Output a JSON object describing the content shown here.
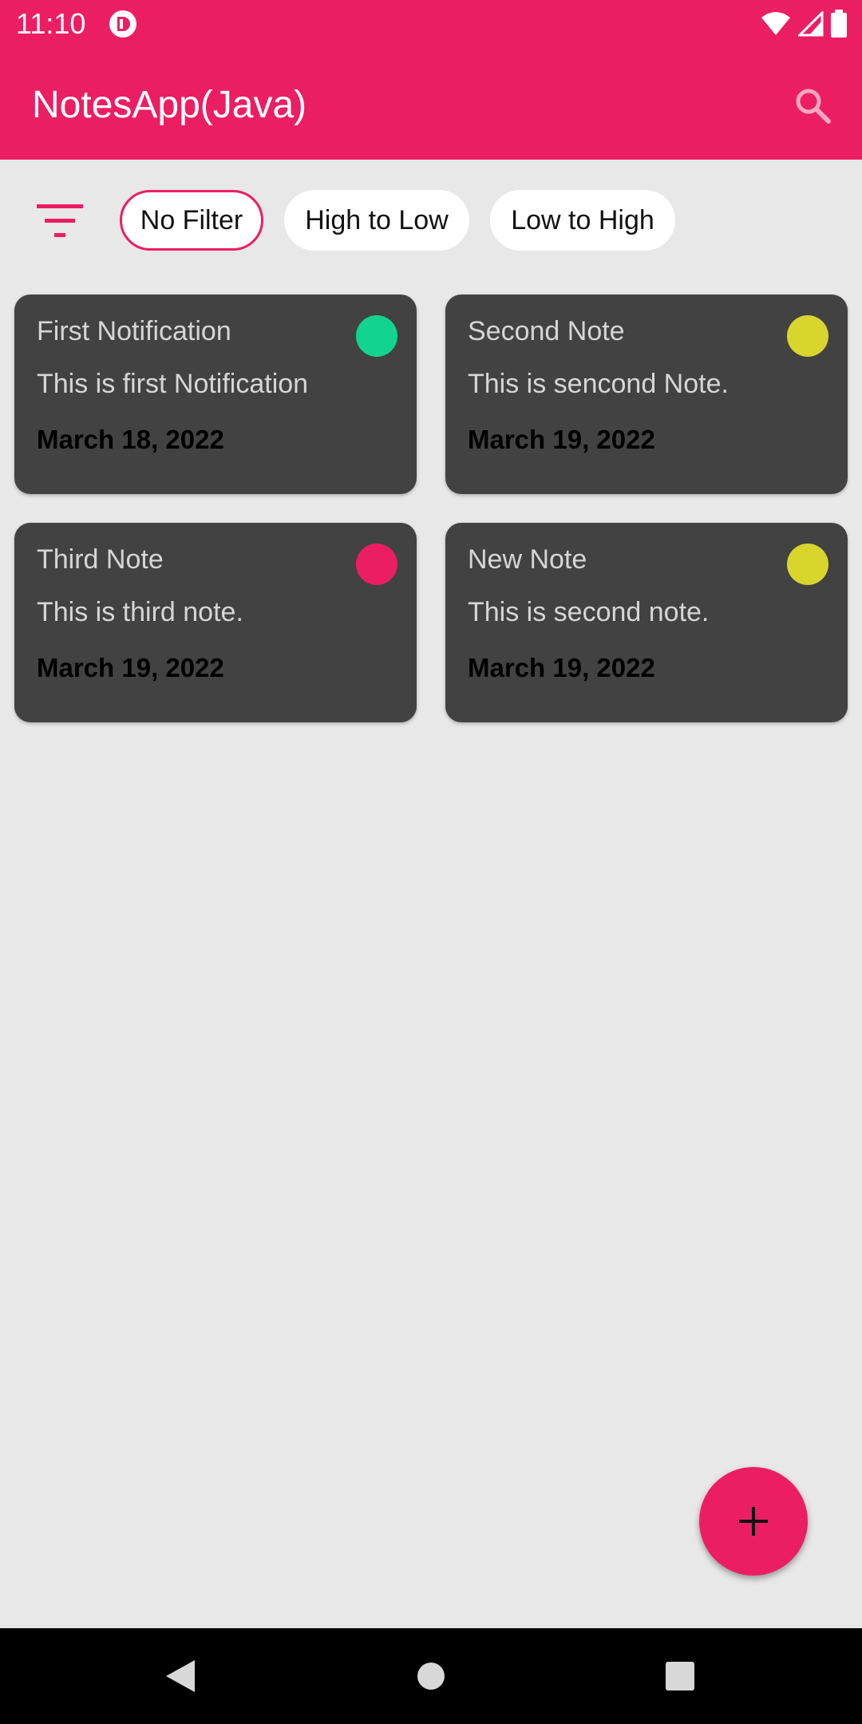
{
  "status_bar": {
    "time": "11:10",
    "icons": [
      "app-notification-icon",
      "wifi-icon",
      "cell-signal-icon",
      "battery-icon"
    ]
  },
  "app_bar": {
    "title": "NotesApp(Java)",
    "search_icon": "search-icon"
  },
  "filters": {
    "icon": "filter-icon",
    "chips": [
      {
        "label": "No Filter",
        "selected": true
      },
      {
        "label": "High to Low",
        "selected": false
      },
      {
        "label": "Low to High",
        "selected": false
      }
    ]
  },
  "notes": [
    {
      "title": "First Notification",
      "body": "This is first Notification",
      "date": "March 18, 2022",
      "priority_color": "#12d38f"
    },
    {
      "title": "Second Note",
      "body": "This is sencond Note.",
      "date": "March 19, 2022",
      "priority_color": "#d8d62c"
    },
    {
      "title": "Third Note",
      "body": "This is third note.",
      "date": "March 19, 2022",
      "priority_color": "#ec1e63"
    },
    {
      "title": "New Note",
      "body": "This is second note.",
      "date": "March 19, 2022",
      "priority_color": "#d8d62c"
    }
  ],
  "fab": {
    "icon": "plus-icon"
  },
  "nav_bar": {
    "buttons": [
      "back-icon",
      "home-icon",
      "recents-icon"
    ]
  },
  "colors": {
    "accent": "#ec1e63",
    "background": "#e8e8e8",
    "card": "#424242"
  }
}
